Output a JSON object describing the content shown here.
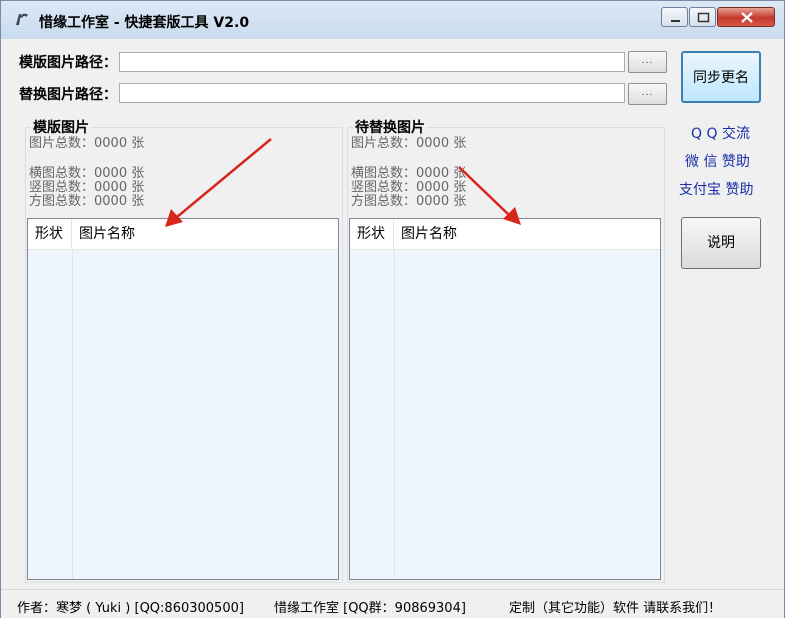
{
  "window": {
    "title": "惜缘工作室 - 快捷套版工具 V2.0"
  },
  "paths": {
    "template_label": "模版图片路径：",
    "template_value": "",
    "replace_label": "替换图片路径：",
    "replace_value": "",
    "browse_label": "..."
  },
  "left_group": {
    "title": "模版图片",
    "total": "图片总数：0000 张",
    "landscape": "横图总数：0000 张",
    "portrait": "竖图总数：0000 张",
    "square": "方图总数：0000 张",
    "col_shape": "形状",
    "col_name": "图片名称"
  },
  "right_group": {
    "title": "待替换图片",
    "total": "图片总数：0000 张",
    "landscape": "横图总数：0000 张",
    "portrait": "竖图总数：0000 张",
    "square": "方图总数：0000 张",
    "col_shape": "形状",
    "col_name": "图片名称"
  },
  "side": {
    "sync_button": "同步更名",
    "qq_link": "Q Q 交流",
    "wechat_link": "微 信 赞助",
    "alipay_link": "支付宝 赞助",
    "help_button": "说明"
  },
  "status": {
    "author": "作者：寒梦 ( Yuki ) [QQ:860300500]",
    "studio": "惜缘工作室 [QQ群：90869304]",
    "custom": "定制（其它功能）软件 请联系我们！"
  },
  "colors": {
    "arrow": "#d9261c",
    "link": "#1a2ea7",
    "list_bg": "#eef5fc"
  }
}
